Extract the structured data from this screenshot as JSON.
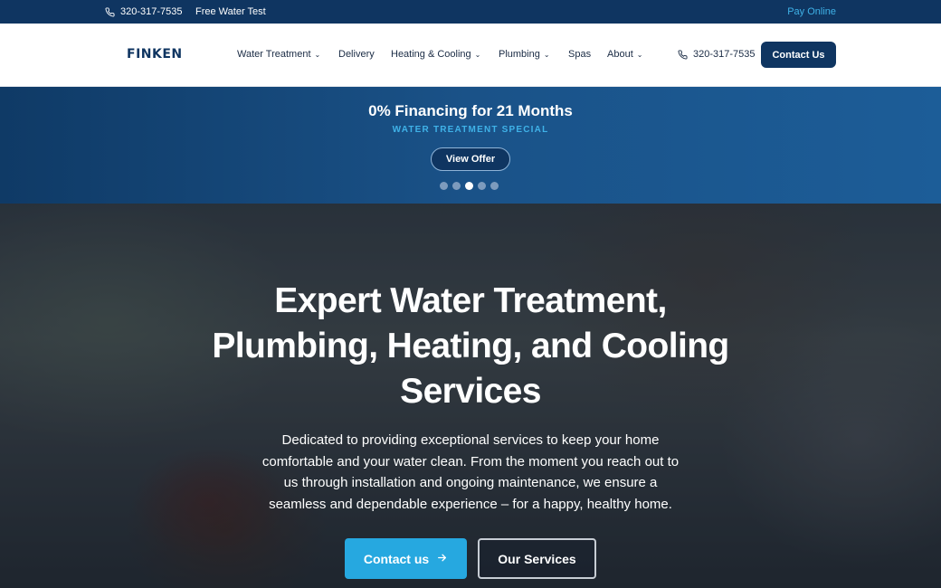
{
  "topbar": {
    "phone": "320-317-7535",
    "free_water_test": "Free Water Test",
    "pay_online": "Pay Online"
  },
  "header": {
    "logo": "FINKEN",
    "nav": [
      {
        "label": "Water Treatment",
        "has_dropdown": true
      },
      {
        "label": "Delivery",
        "has_dropdown": false
      },
      {
        "label": "Heating & Cooling",
        "has_dropdown": true
      },
      {
        "label": "Plumbing",
        "has_dropdown": true
      },
      {
        "label": "Spas",
        "has_dropdown": false
      },
      {
        "label": "About",
        "has_dropdown": true
      }
    ],
    "phone": "320-317-7535",
    "contact_button": "Contact Us"
  },
  "promo": {
    "title": "0% Financing for 21 Months",
    "subtitle": "WATER TREATMENT SPECIAL",
    "button": "View Offer",
    "slide_count": 5,
    "active_slide": 3
  },
  "hero": {
    "headline": "Expert Water Treatment, Plumbing, Heating, and Cooling Services",
    "body": "Dedicated to providing exceptional services to keep your home comfortable and your water clean. From the moment you reach out to us through installation and ongoing maintenance, we ensure a seamless and dependable experience – for a happy, healthy home.",
    "primary_button": "Contact us",
    "secondary_button": "Our Services"
  },
  "colors": {
    "navy": "#0f3561",
    "accent_blue": "#26a8e0",
    "light_blue": "#3fb2e8"
  }
}
